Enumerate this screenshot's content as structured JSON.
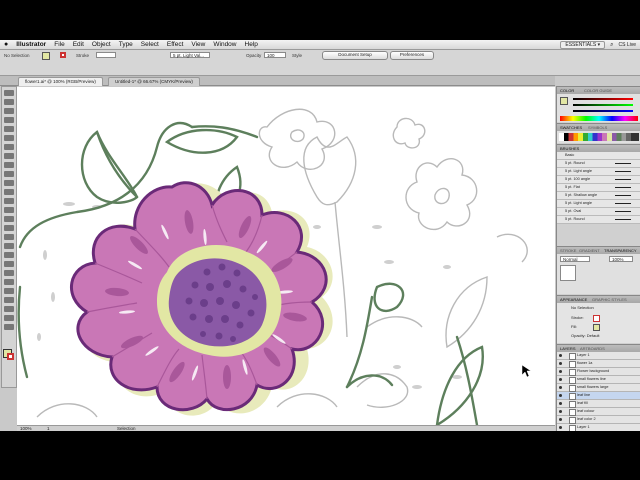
{
  "menubar": {
    "apple": "",
    "app_name": "Illustrator",
    "items": [
      "File",
      "Edit",
      "Object",
      "Type",
      "Select",
      "Effect",
      "View",
      "Window",
      "Help"
    ],
    "workspace": "ESSENTIALS ▾",
    "right_text": "CS Live"
  },
  "control": {
    "selection_label": "No Selection",
    "stroke_label": "Stroke",
    "brush_value": "5 pt. Light Val...",
    "opacity_label": "Opacity",
    "opacity_value": "100",
    "style_label": "Style",
    "doc_setup": "Document Setup",
    "preferences": "Preferences"
  },
  "tabs": [
    {
      "label": "flower1.ai* @ 100% (RGB/Preview)",
      "active": true
    },
    {
      "label": "Untitled-1* @ 66.67% (CMYK/Preview)",
      "active": false
    }
  ],
  "statusbar": {
    "zoom": "100%",
    "page": "1",
    "tool": "Selection"
  },
  "panels": {
    "color": {
      "tab1": "COLOR",
      "tab2": "COLOR GUIDE"
    },
    "swatches": {
      "tab1": "SWATCHES",
      "tab2": "SYMBOLS"
    },
    "brushes": {
      "tab1": "BRUSHES",
      "rows": [
        "Basic",
        "5 pt. Round",
        "5 pt. Light angle",
        "5 pt. 100 angle",
        "5 pt. Flat",
        "5 pt. Shallow angle",
        "5 pt. Light angle",
        "5 pt. Oval",
        "5 pt. Round"
      ]
    },
    "stroke": {
      "tab1": "STROKE",
      "tab2": "GRADIENT",
      "tab3": "TRANSPARENCY",
      "mode": "Normal",
      "opacity": "100%"
    },
    "appearance": {
      "tab1": "APPEARANCE",
      "tab2": "GRAPHIC STYLES",
      "selection": "No Selection",
      "stroke": "Stroke:",
      "fill": "Fill:",
      "opacity": "Opacity: Default"
    },
    "layers": {
      "tab1": "LAYERS",
      "tab2": "ARTBOARDS",
      "rows": [
        "Layer 1",
        "flower 1a",
        "Flower background",
        "small flowers line",
        "small flowers large",
        "leaf line",
        "leaf fill",
        "leaf colour",
        "leaf color 2",
        "Layer 1"
      ]
    }
  },
  "colors": {
    "petal": "#c977b6",
    "petal_dark": "#a9579a",
    "outline": "#6a2a78",
    "center_ring": "#e2e7a4",
    "center": "#8a59a6",
    "seed": "#6b3e8a",
    "leaf_line": "#5d7f5c",
    "sketch": "#b9b9b9"
  }
}
